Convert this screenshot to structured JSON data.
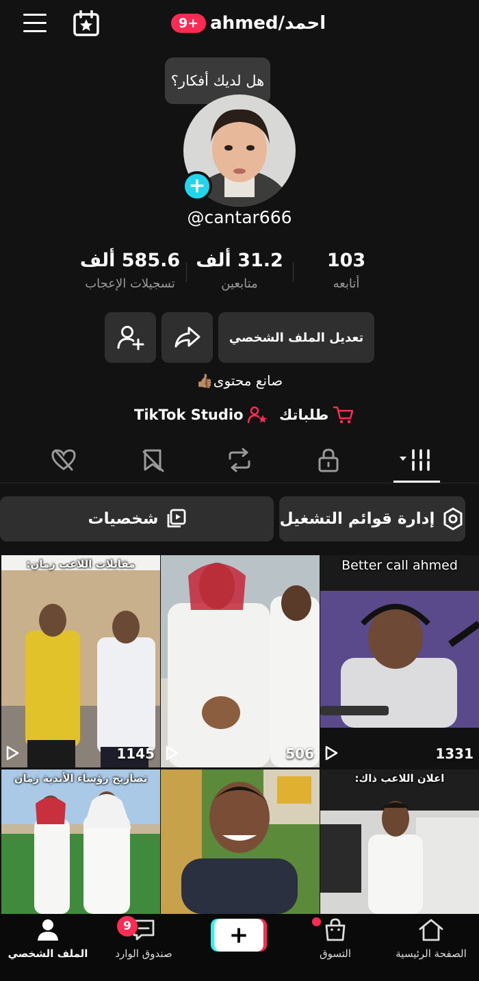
{
  "header": {
    "notification_badge": "9+",
    "title": "ahmed/احمد",
    "tooltip": "هل لديك أفكار؟"
  },
  "profile": {
    "handle": "@cantar666",
    "stats": [
      {
        "value": "585.6 ألف",
        "label": "تسجيلات الإعجاب"
      },
      {
        "value": "31.2 ألف",
        "label": "متابعين"
      },
      {
        "value": "103",
        "label": "أتابعه"
      }
    ],
    "edit_button": "تعديل الملف الشخصي",
    "bio": "صانع محتوى👍🏽",
    "links": {
      "studio": "TikTok Studio",
      "orders": "طلباتك"
    }
  },
  "tabs": [
    {
      "icon": "grid-icon",
      "active": true
    },
    {
      "icon": "lock-icon",
      "active": false
    },
    {
      "icon": "repost-icon",
      "active": false
    },
    {
      "icon": "bookmark-icon",
      "active": false
    },
    {
      "icon": "liked-icon",
      "active": false
    }
  ],
  "actions": {
    "playlists": "إدارة قوائم التشغيل",
    "characters": "شخصيات"
  },
  "videos": [
    {
      "caption": "مقابلات اللاعب زمان:",
      "views": "1145"
    },
    {
      "caption": "",
      "views": "506"
    },
    {
      "caption": "Better call ahmed",
      "views": "1331"
    },
    {
      "caption": "تصاريح رؤساء الأندية زمان",
      "views": ""
    },
    {
      "caption": "",
      "views": ""
    },
    {
      "caption": "اعلان اللاعب ذاك:",
      "views": ""
    }
  ],
  "bottom_nav": {
    "profile": "الملف الشخصي",
    "inbox": "صندوق الوارد",
    "inbox_badge": "9",
    "shop": "التسوق",
    "home": "الصفحة الرئيسية"
  },
  "colors": {
    "background": "#121212",
    "accent_red": "#fe2c55",
    "accent_cyan": "#20d5ec",
    "button_bg": "#2f2f2f"
  }
}
